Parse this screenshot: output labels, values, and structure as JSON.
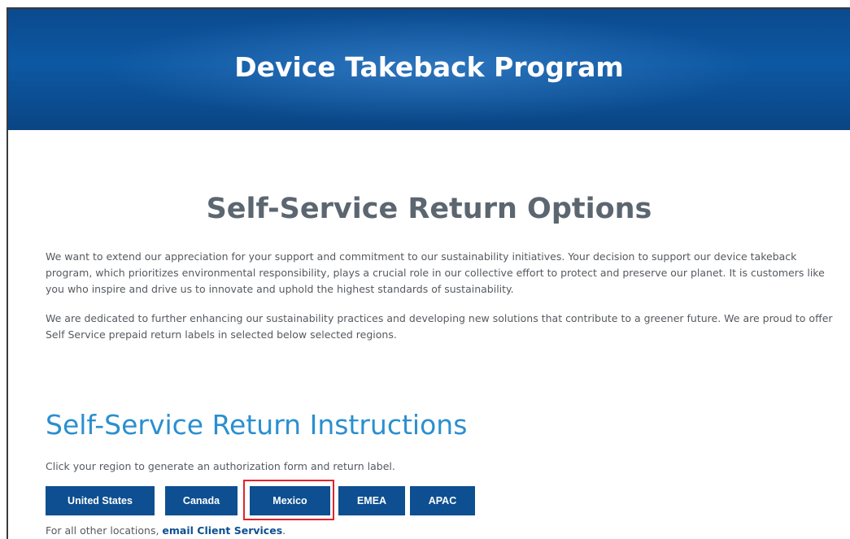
{
  "hero": {
    "title": "Device Takeback Program"
  },
  "section": {
    "title": "Self-Service Return Options",
    "paragraphs": [
      "We want to extend our appreciation for your support and commitment to our sustainability initiatives. Your decision to support our device takeback program, which prioritizes environmental responsibility, plays a crucial role in our collective effort to protect and preserve our planet. It is customers like you who inspire and drive us to innovate and uphold the highest standards of sustainability.",
      "We are dedicated to further enhancing our sustainability practices and developing new solutions that contribute to a greener future. We are proud to offer Self Service prepaid return labels in selected below selected regions."
    ]
  },
  "instructions": {
    "title": "Self-Service Return Instructions",
    "text": "Click your region to generate an authorization form and return label.",
    "regions": [
      "United States",
      "Canada",
      "Mexico",
      "EMEA",
      "APAC"
    ],
    "highlighted_region": "Mexico"
  },
  "footer": {
    "prefix": "For all other locations, ",
    "link_label": "email Client Services",
    "suffix": "."
  },
  "colors": {
    "hero_blue": "#0d58a3",
    "button_blue": "#0d4f91",
    "heading_blue": "#2a8fd0",
    "heading_gray": "#5b6670",
    "highlight_red": "#e0242b"
  }
}
